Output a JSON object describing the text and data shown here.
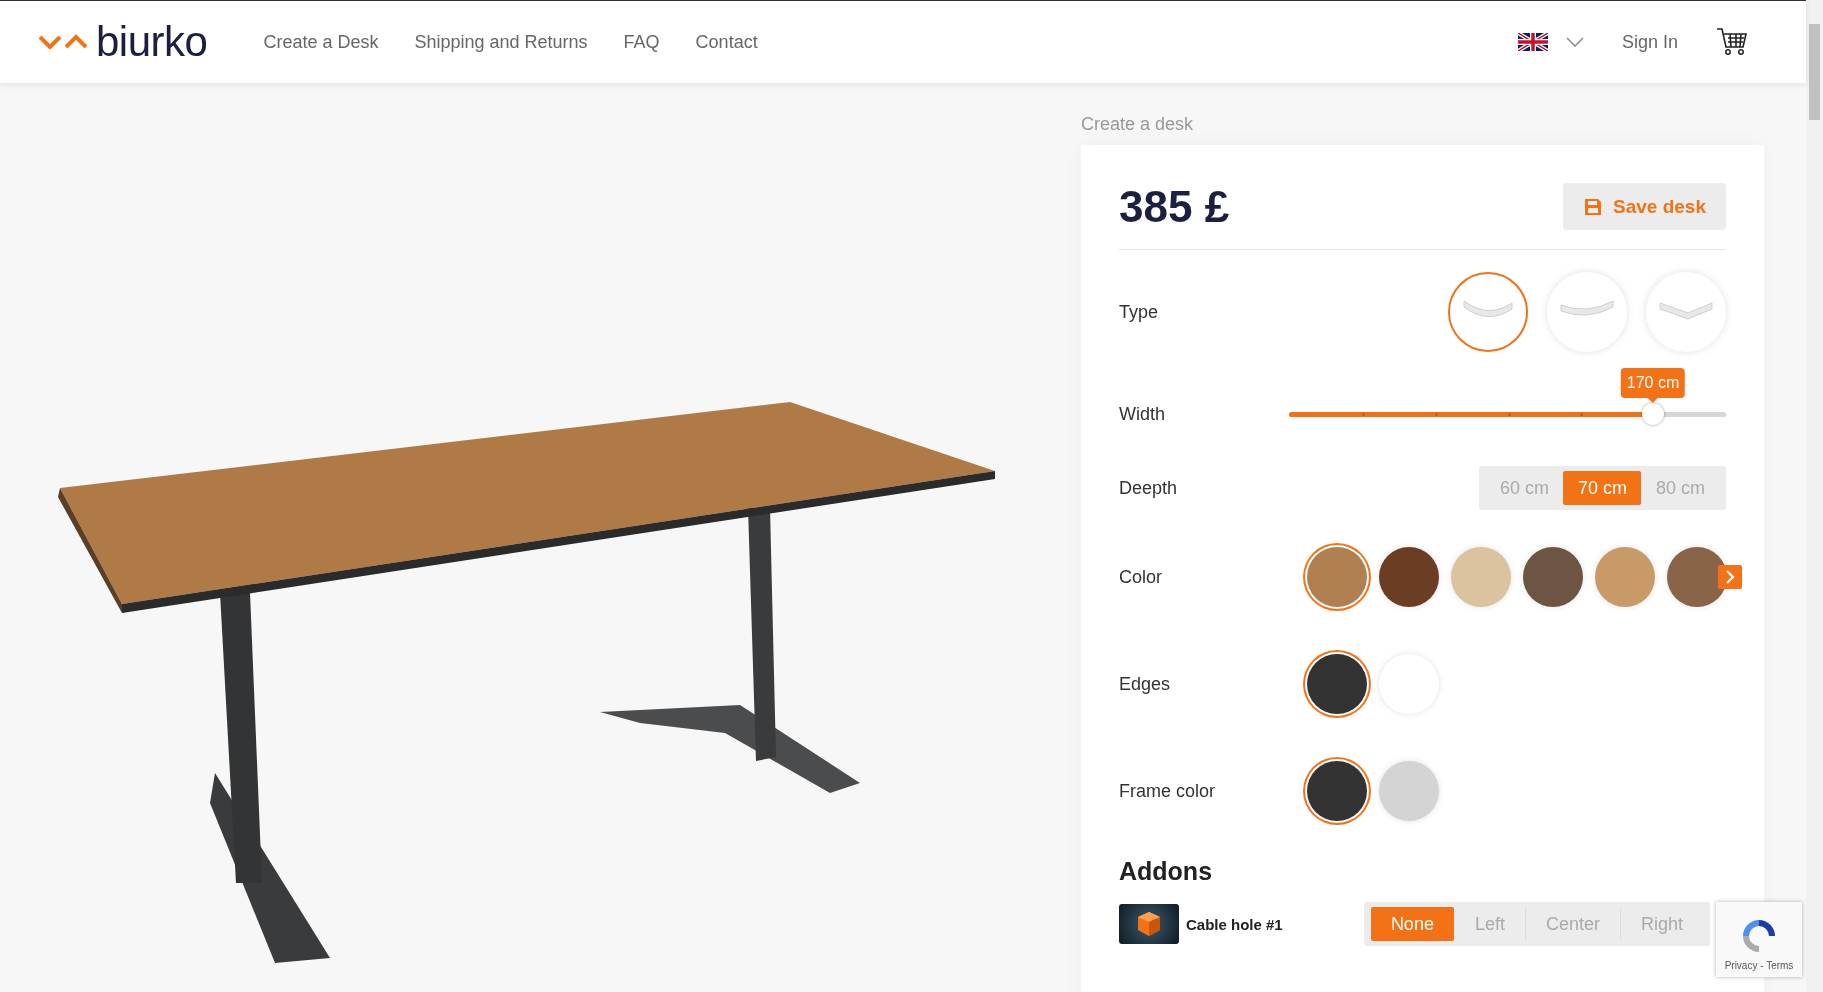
{
  "header": {
    "logo": "biurko",
    "nav": [
      {
        "label": "Create a Desk"
      },
      {
        "label": "Shipping and Returns"
      },
      {
        "label": "FAQ"
      },
      {
        "label": "Contact"
      }
    ],
    "sign_in": "Sign In"
  },
  "breadcrumb": "Create a desk",
  "price": "385 £",
  "save_button": "Save desk",
  "options": [
    {
      "kind": "shape",
      "label": "Type",
      "choices": [
        {
          "kind": "rounded",
          "selected": true
        },
        {
          "kind": "curved",
          "selected": false
        },
        {
          "kind": "angled",
          "selected": false
        }
      ]
    },
    {
      "kind": "slider",
      "label": "Width",
      "level": 0.833,
      "reading": "170 cm"
    },
    {
      "kind": "segmented",
      "label": "Deepth",
      "choices": [
        {
          "label": "60 cm",
          "selected": false
        },
        {
          "label": "70 cm",
          "selected": true
        },
        {
          "label": "80 cm",
          "selected": false
        }
      ]
    },
    {
      "kind": "swatch",
      "label": "Color",
      "more": true,
      "choices": [
        {
          "color": "#b07f52",
          "selected": true
        },
        {
          "color": "#6b3d22",
          "selected": false
        },
        {
          "color": "#dcc3a0",
          "selected": false
        },
        {
          "color": "#6e5443",
          "selected": false
        },
        {
          "color": "#c89a68",
          "selected": false
        },
        {
          "color": "#8a6448",
          "selected": false
        }
      ]
    },
    {
      "kind": "swatch",
      "label": "Edges",
      "choices": [
        {
          "color": "#333333",
          "selected": true
        },
        {
          "color": "#ffffff",
          "selected": false
        }
      ]
    },
    {
      "kind": "swatch",
      "label": "Frame color",
      "choices": [
        {
          "color": "#333333",
          "selected": true
        },
        {
          "color": "#d4d4d4",
          "selected": false
        }
      ]
    }
  ],
  "addons": {
    "title": "Addons",
    "items": [
      {
        "name": "Cable hole #1",
        "choices": [
          {
            "label": "None",
            "selected": true
          },
          {
            "label": "Left",
            "selected": false
          },
          {
            "label": "Center",
            "selected": false
          },
          {
            "label": "Right",
            "selected": false
          }
        ]
      }
    ]
  },
  "recaptcha": {
    "links": "Privacy - Terms"
  }
}
